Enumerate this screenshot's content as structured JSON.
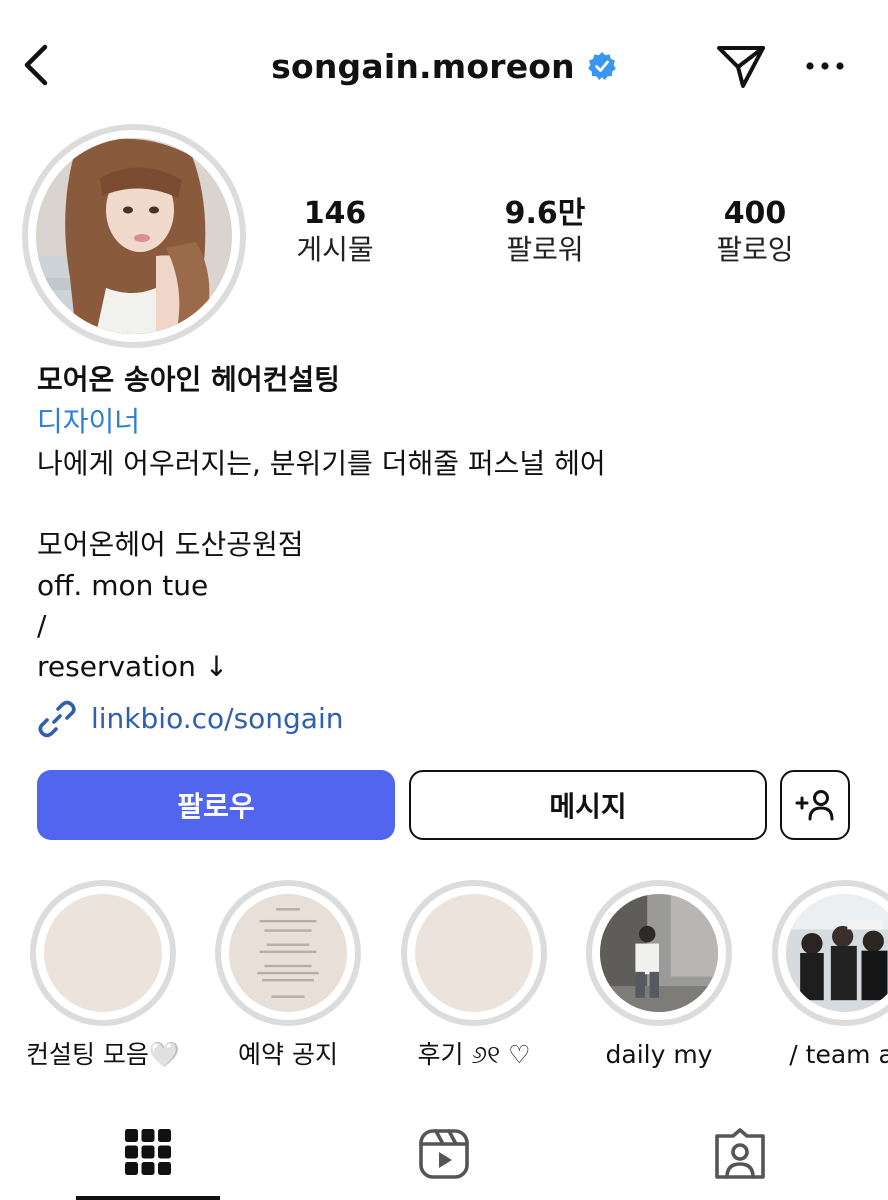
{
  "header": {
    "username": "songain.moreon",
    "verified_color": "#3897f0",
    "back_icon": "chevron-left-icon",
    "send_icon": "send-icon",
    "more_icon": "more-horizontal-icon"
  },
  "stats": [
    {
      "value": "146",
      "label": "게시물"
    },
    {
      "value": "9.6만",
      "label": "팔로워"
    },
    {
      "value": "400",
      "label": "팔로잉"
    }
  ],
  "bio": {
    "name": "모어온 송아인 헤어컨설팅",
    "category": "디자이너",
    "lines": [
      "나에게 어우러지는, 분위기를 더해줄 퍼스널 헤어",
      "",
      "모어온헤어 도산공원점",
      "off. mon tue",
      "/",
      "reservation ↓"
    ],
    "link": "linkbio.co/songain"
  },
  "buttons": {
    "follow": "팔로우",
    "message": "메시지",
    "follow_color": "#5165ef"
  },
  "highlights": [
    {
      "label": "컨설팅 모음🤍"
    },
    {
      "label": "예약 공지"
    },
    {
      "label": "후기 ୬୧ ♡"
    },
    {
      "label": "daily my"
    },
    {
      "label": "/ team ai"
    }
  ],
  "tabs": [
    {
      "icon": "grid-icon",
      "active": true
    },
    {
      "icon": "reels-icon",
      "active": false
    },
    {
      "icon": "tagged-icon",
      "active": false
    }
  ]
}
